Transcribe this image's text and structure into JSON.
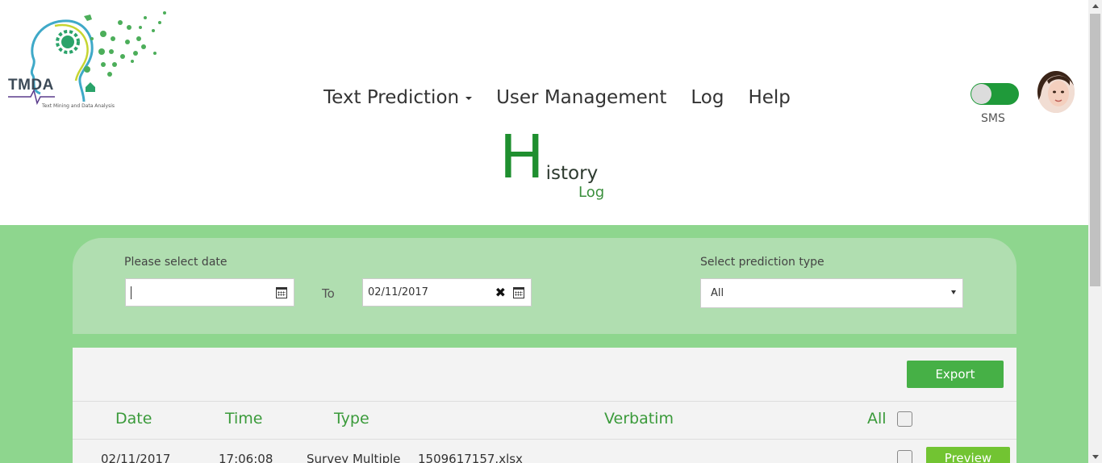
{
  "logo": {
    "name": "TMDA",
    "tagline": "Text Mining and Data Analysis"
  },
  "nav": {
    "items": [
      {
        "label": "Text Prediction",
        "has_dropdown": true
      },
      {
        "label": "User Management"
      },
      {
        "label": "Log"
      },
      {
        "label": "Help"
      }
    ]
  },
  "sms_toggle": {
    "label": "SMS",
    "on": true
  },
  "page": {
    "title_initial": "H",
    "title_rest": "istory",
    "subtitle": "Log"
  },
  "filters": {
    "date_label": "Please select date",
    "from_value": "",
    "to_label": "To",
    "to_value": "02/11/2017",
    "type_label": "Select prediction type",
    "type_selected": "All"
  },
  "table": {
    "export_label": "Export",
    "headers": {
      "date": "Date",
      "time": "Time",
      "type": "Type",
      "verbatim": "Verbatim",
      "all": "All"
    },
    "rows": [
      {
        "date": "02/11/2017",
        "time": "17:06:08",
        "type": "Survey Multiple",
        "verbatim": "1509617157.xlsx",
        "action": "Preview"
      }
    ]
  },
  "colors": {
    "brand_green": "#1f8f2f",
    "band_green": "#8ed68e",
    "panel_green": "#b0deb0",
    "button_green": "#46b046",
    "preview_green": "#72c432"
  }
}
